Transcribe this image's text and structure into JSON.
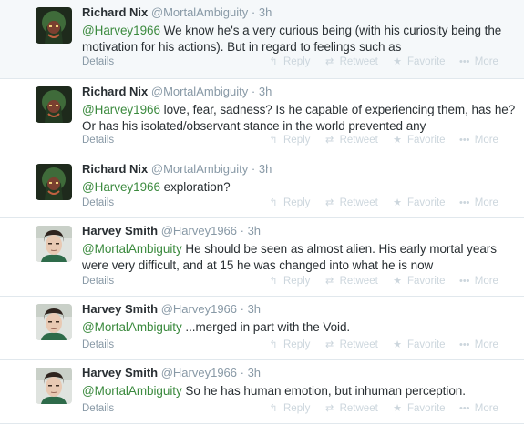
{
  "actions": {
    "reply": "Reply",
    "retweet": "Retweet",
    "favorite": "Favorite",
    "more": "More",
    "details": "Details"
  },
  "icons": {
    "reply": "reply-icon",
    "retweet": "retweet-icon",
    "favorite": "star-icon",
    "more": "more-dots-icon"
  },
  "colors": {
    "mention": "#3b8a3e",
    "muted": "#8899a6",
    "action": "#ccd6dd",
    "divider": "#e1e8ed",
    "hover_bg": "#f5f8fa"
  },
  "tweets": [
    {
      "name": "Richard Nix",
      "handle": "@MortalAmbiguity",
      "time": "3h",
      "mention": "@Harvey1966",
      "body": " We know he's a very curious being (with his curiosity being the motivation for his actions). But in regard to feelings such as"
    },
    {
      "name": "Richard Nix",
      "handle": "@MortalAmbiguity",
      "time": "3h",
      "mention": "@Harvey1966",
      "body": " love, fear, sadness? Is he capable of experiencing them, has he? Or has his isolated/observant stance in the world prevented any"
    },
    {
      "name": "Richard Nix",
      "handle": "@MortalAmbiguity",
      "time": "3h",
      "mention": "@Harvey1966",
      "body": " exploration?"
    },
    {
      "name": "Harvey Smith",
      "handle": "@Harvey1966",
      "time": "3h",
      "mention": "@MortalAmbiguity",
      "body": " He should be seen as almost alien. His early mortal years were very difficult, and at 15 he was changed into what he is now"
    },
    {
      "name": "Harvey Smith",
      "handle": "@Harvey1966",
      "time": "3h",
      "mention": "@MortalAmbiguity",
      "body": " ...merged in part with the Void."
    },
    {
      "name": "Harvey Smith",
      "handle": "@Harvey1966",
      "time": "3h",
      "mention": "@MortalAmbiguity",
      "body": " So he has human emotion, but inhuman perception."
    }
  ]
}
